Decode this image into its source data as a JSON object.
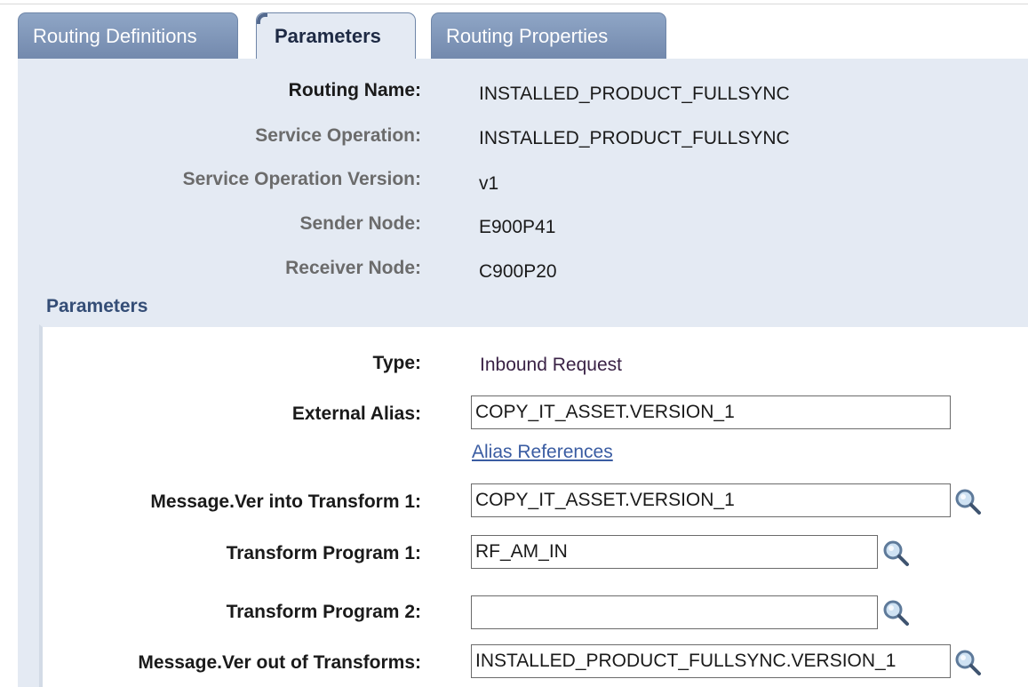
{
  "tabs": [
    {
      "label": "Routing Definitions"
    },
    {
      "label": "Parameters"
    },
    {
      "label": "Routing Properties"
    }
  ],
  "header_fields": {
    "routing_name": {
      "label": "Routing Name:",
      "value": "INSTALLED_PRODUCT_FULLSYNC"
    },
    "service_operation": {
      "label": "Service Operation:",
      "value": "INSTALLED_PRODUCT_FULLSYNC"
    },
    "service_operation_version": {
      "label": "Service Operation Version:",
      "value": "v1"
    },
    "sender_node": {
      "label": "Sender Node:",
      "value": "E900P41"
    },
    "receiver_node": {
      "label": "Receiver Node:",
      "value": "C900P20"
    }
  },
  "parameters": {
    "section_title": "Parameters",
    "type": {
      "label": "Type:",
      "value": "Inbound Request"
    },
    "external_alias": {
      "label": "External Alias:",
      "value": "COPY_IT_ASSET.VERSION_1"
    },
    "alias_references_link": "Alias References",
    "msg_into_transform1": {
      "label": "Message.Ver into Transform 1:",
      "value": "COPY_IT_ASSET.VERSION_1"
    },
    "transform_program1": {
      "label": "Transform Program 1:",
      "value": "RF_AM_IN"
    },
    "transform_program2": {
      "label": "Transform Program 2:",
      "value": ""
    },
    "msg_out_of_transforms": {
      "label": "Message.Ver out of Transforms:",
      "value": "INSTALLED_PRODUCT_FULLSYNC.VERSION_1"
    }
  },
  "icons": {
    "lookup": "magnifying-glass-lookup-icon"
  },
  "colors": {
    "tab_inactive": "#7d93b7",
    "tab_active": "#e4eaf3",
    "panel_bg": "#e4eaf3",
    "section_title": "#344d76",
    "link": "#3a5ca2"
  }
}
